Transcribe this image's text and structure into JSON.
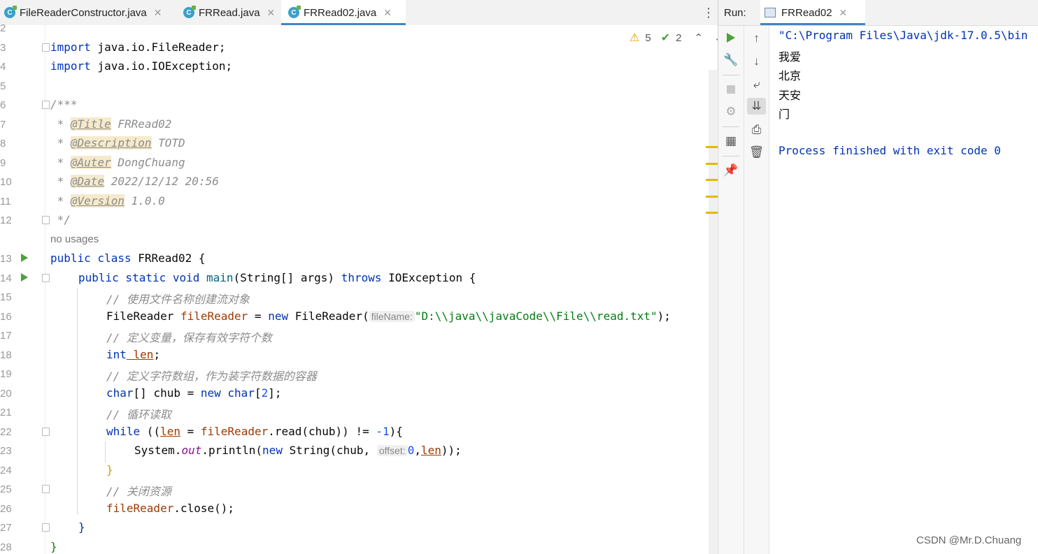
{
  "tabs": [
    {
      "label": "FileReaderConstructor.java",
      "icon": "java-class-icon"
    },
    {
      "label": "FRRead.java",
      "icon": "java-class-icon"
    },
    {
      "label": "FRRead02.java",
      "icon": "java-class-icon",
      "active": true
    }
  ],
  "inspections": {
    "warnings": "5",
    "weak_warnings": "2"
  },
  "line_numbers": [
    "2",
    "3",
    "4",
    "5",
    "6",
    "7",
    "8",
    "9",
    "10",
    "11",
    "12",
    "13",
    "14",
    "15",
    "16",
    "17",
    "18",
    "19",
    "20",
    "21",
    "22",
    "23",
    "24",
    "25",
    "26",
    "27",
    "28"
  ],
  "code": {
    "l3_kw": "import",
    "l3_rest": " java.io.FileReader;",
    "l4_kw": "import",
    "l4_rest": " java.io.IOException;",
    "l6": "/***",
    "l7_star": " * ",
    "l7_tag": "@Title",
    "l7_val": " FRRead02",
    "l8_star": " * ",
    "l8_tag": "@Description",
    "l8_val": " TOTD",
    "l9_star": " * ",
    "l9_tag": "@Auter",
    "l9_val": " DongChuang",
    "l10_star": " * ",
    "l10_tag": "@Date",
    "l10_val": " 2022/12/12 20:56",
    "l11_star": " * ",
    "l11_tag": "@Version",
    "l11_val": " 1.0.0",
    "l12": " */",
    "usages": "no usages",
    "l13_kw": "public class",
    "l13_rest": " FRRead02 {",
    "l14_kw": "public static void",
    "l14_m": " main",
    "l14_a": "(String[] ",
    "l14_args": "args",
    "l14_b": ") ",
    "l14_kw2": "throws",
    "l14_c": " IOException {",
    "l15": "// 使用文件名称创建流对象",
    "l16_a": "FileReader ",
    "l16_var": "fileReader",
    "l16_b": " = ",
    "l16_kw": "new",
    "l16_c": " FileReader(",
    "l16_hint": "fileName:",
    "l16_str": "\"D:\\\\java\\\\javaCode\\\\File\\\\read.txt\"",
    "l16_d": ");",
    "l17": "// 定义变量，保存有效字符个数",
    "l18_kw": "int",
    "l18_var": " len",
    "l18_rest": ";",
    "l19": "// 定义字符数组，作为装字符数据的容器",
    "l20_kw": "char",
    "l20_a": "[] ",
    "l20_v": "chub",
    "l20_b": " = ",
    "l20_kw2": "new",
    "l20_kw3": " char",
    "l20_c": "[",
    "l20_n": "2",
    "l20_d": "];",
    "l21": "// 循环读取",
    "l22_kw": "while",
    "l22_a": " ((",
    "l22_len": "len",
    "l22_b": " = ",
    "l22_var": "fileReader",
    "l22_c": ".read(",
    "l22_v": "chub",
    "l22_d": ")) != ",
    "l22_n": "-1",
    "l22_e": "){",
    "l23_a": "System.",
    "l23_fld": "out",
    "l23_b": ".println(",
    "l23_kw": "new",
    "l23_c": " String(",
    "l23_v": "chub",
    "l23_d": ", ",
    "l23_hint": "offset:",
    "l23_n": "0",
    "l23_e": ",",
    "l23_len": "len",
    "l23_f": "));",
    "l24": "}",
    "l25": "// 关闭资源",
    "l26_var": "fileReader",
    "l26_rest": ".close();",
    "l27": "}",
    "l28": "}"
  },
  "run": {
    "label": "Run:",
    "tab": "FRRead02",
    "console": [
      "\"C:\\Program Files\\Java\\jdk-17.0.5\\bin",
      "我爱",
      "北京",
      "天安",
      "门",
      "",
      "Process finished with exit code 0"
    ]
  },
  "watermark": "CSDN @Mr.D.Chuang",
  "colors": {
    "keyword": "#0033b3",
    "string": "#067d17",
    "comment": "#8c8c8c",
    "accent": "#4083c9"
  }
}
